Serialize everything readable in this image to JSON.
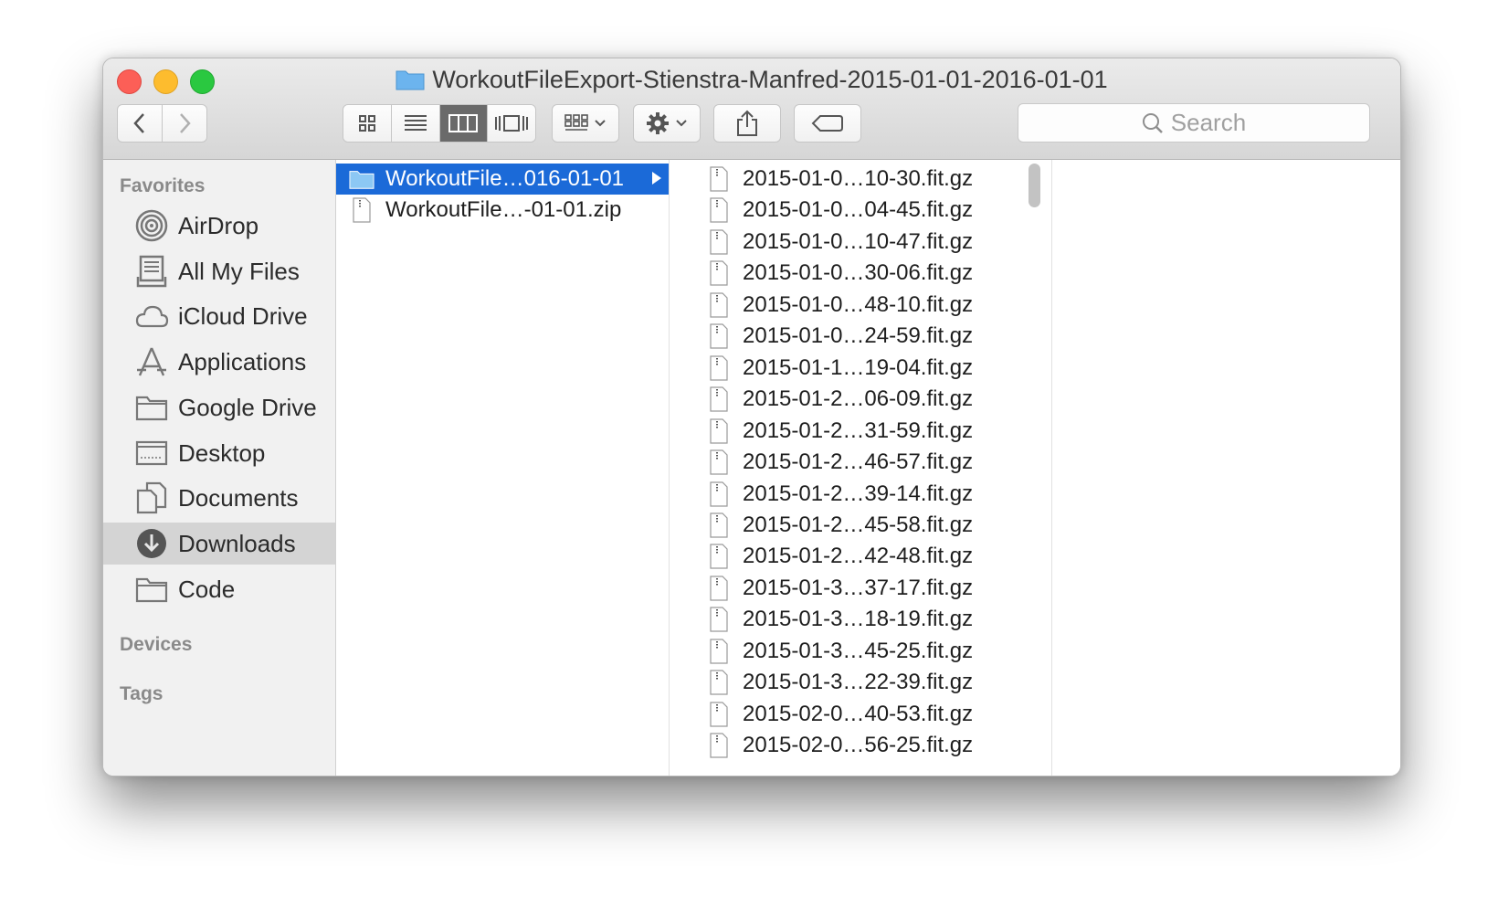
{
  "window": {
    "title": "WorkoutFileExport-Stienstra-Manfred-2015-01-01-2016-01-01"
  },
  "toolbar": {
    "back": "back-arrow",
    "forward": "forward-arrow",
    "views": [
      "icon-view",
      "list-view",
      "column-view",
      "cover-flow-view"
    ],
    "active_view": "column-view",
    "search_placeholder": "Search"
  },
  "sidebar": {
    "favorites_heading": "Favorites",
    "items": [
      {
        "label": "AirDrop",
        "icon": "airdrop-icon"
      },
      {
        "label": "All My Files",
        "icon": "all-files-icon"
      },
      {
        "label": "iCloud Drive",
        "icon": "cloud-icon"
      },
      {
        "label": "Applications",
        "icon": "applications-icon"
      },
      {
        "label": "Google Drive",
        "icon": "folder-icon"
      },
      {
        "label": "Desktop",
        "icon": "desktop-icon"
      },
      {
        "label": "Documents",
        "icon": "documents-icon"
      },
      {
        "label": "Downloads",
        "icon": "downloads-icon",
        "selected": true
      },
      {
        "label": "Code",
        "icon": "folder-icon"
      }
    ],
    "devices_heading": "Devices",
    "tags_heading": "Tags"
  },
  "column1": [
    {
      "name": "WorkoutFile…016-01-01",
      "type": "folder",
      "selected": true
    },
    {
      "name": "WorkoutFile…-01-01.zip",
      "type": "zip"
    }
  ],
  "column2": [
    "2015-01-0…10-30.fit.gz",
    "2015-01-0…04-45.fit.gz",
    "2015-01-0…10-47.fit.gz",
    "2015-01-0…30-06.fit.gz",
    "2015-01-0…48-10.fit.gz",
    "2015-01-0…24-59.fit.gz",
    "2015-01-1…19-04.fit.gz",
    "2015-01-2…06-09.fit.gz",
    "2015-01-2…31-59.fit.gz",
    "2015-01-2…46-57.fit.gz",
    "2015-01-2…39-14.fit.gz",
    "2015-01-2…45-58.fit.gz",
    "2015-01-2…42-48.fit.gz",
    "2015-01-3…37-17.fit.gz",
    "2015-01-3…18-19.fit.gz",
    "2015-01-3…45-25.fit.gz",
    "2015-01-3…22-39.fit.gz",
    "2015-02-0…40-53.fit.gz",
    "2015-02-0…56-25.fit.gz"
  ],
  "colors": {
    "selection": "#1b6ad8",
    "folder": "#6cb4ee"
  }
}
